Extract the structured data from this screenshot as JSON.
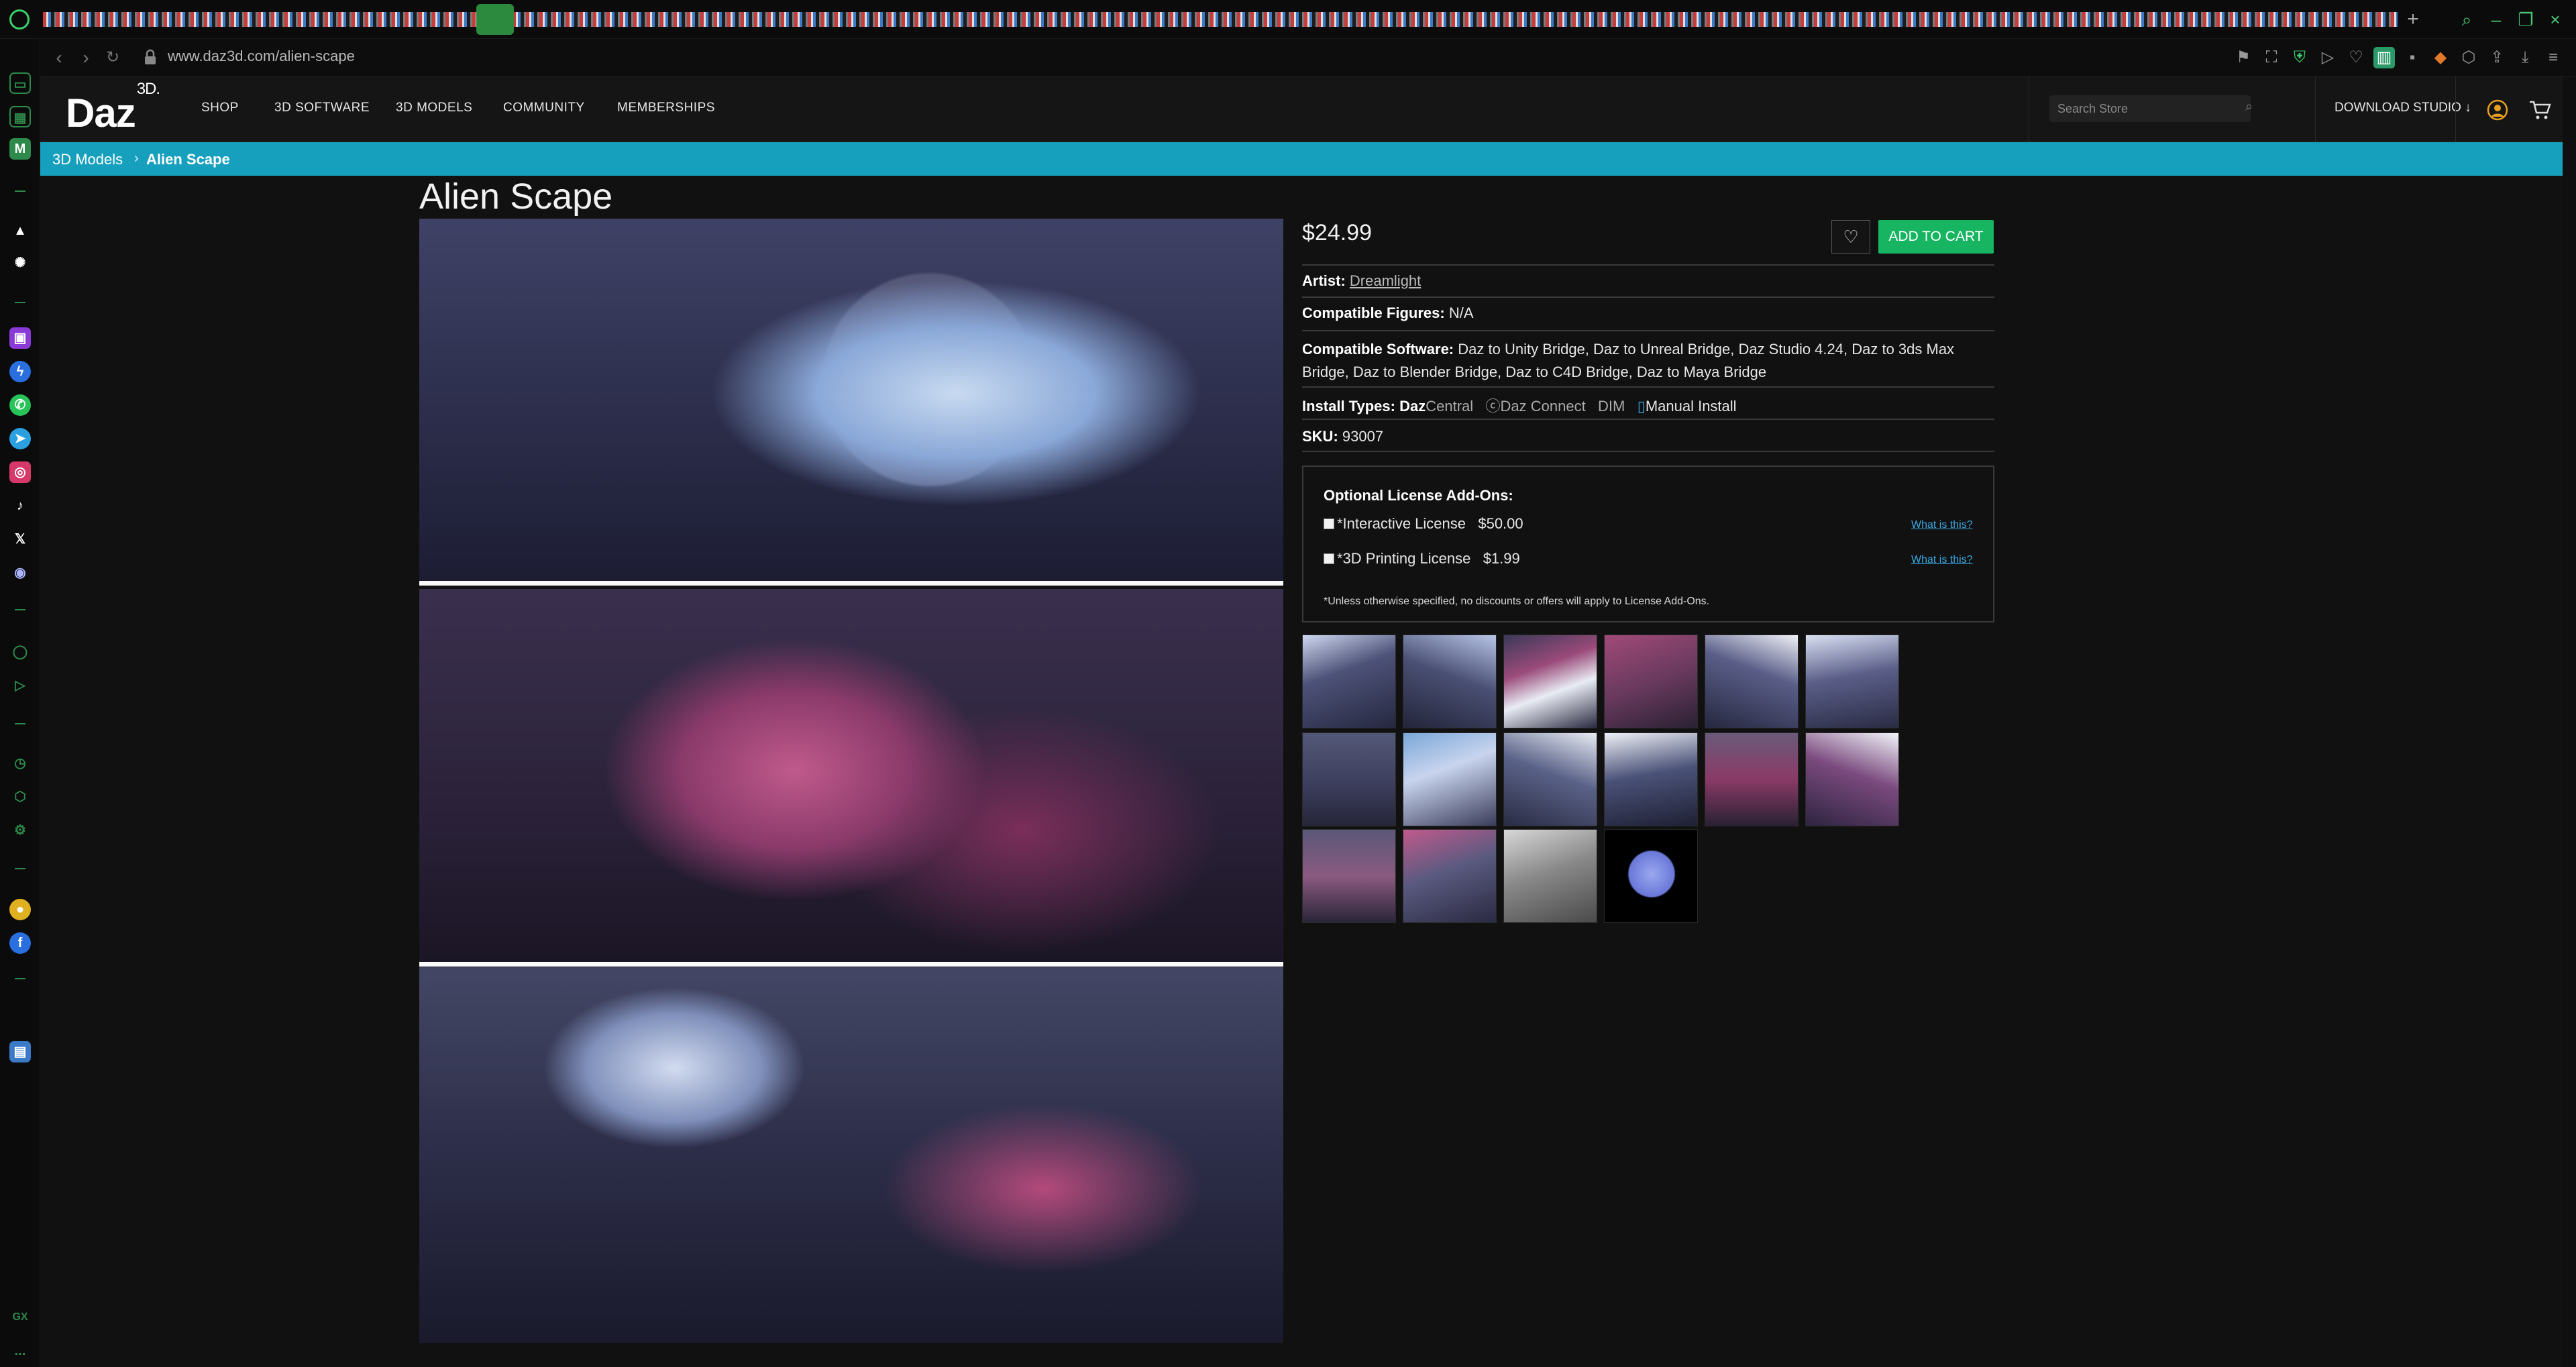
{
  "browser": {
    "url": "www.daz3d.com/alien-scape",
    "extension_icons": [
      "bookmark-icon",
      "screenshot-icon",
      "shield-icon",
      "play-icon",
      "heart-icon",
      "app-icon",
      "vpn-icon",
      "box-icon",
      "puzzle-icon",
      "share-icon",
      "download-icon",
      "menu-icon"
    ],
    "sidebar_icons": [
      "mail-icon",
      "pad-icon",
      "m-icon",
      "a-icon",
      "ai-icon",
      "twitch-icon",
      "messenger-icon",
      "whatsapp-icon",
      "telegram-icon",
      "instagram-icon",
      "tiktok-icon",
      "x-icon",
      "discord-icon",
      "player-icon",
      "send-icon",
      "clock-icon",
      "extensions-icon",
      "settings-icon",
      "chat-icon",
      "facebook-icon",
      "app-icon"
    ],
    "gx_label": "GX",
    "more_label": "..."
  },
  "site": {
    "logo": "Daz",
    "logo_sup": "3D.",
    "nav": [
      "SHOP",
      "3D SOFTWARE",
      "3D MODELS",
      "COMMUNITY",
      "MEMBERSHIPS"
    ],
    "search_placeholder": "Search Store",
    "download_studio": "DOWNLOAD STUDIO",
    "breadcrumb": {
      "parent": "3D Models",
      "sep": "›",
      "current": "Alien Scape"
    }
  },
  "product": {
    "title": "Alien Scape",
    "price": "$24.99",
    "add_to_cart": "ADD TO CART",
    "artist_label": "Artist:",
    "artist": "Dreamlight",
    "figures_label": "Compatible Figures:",
    "figures": "N/A",
    "software_label": "Compatible Software:",
    "software_line1": "Daz to Unity Bridge, Daz to Unreal Bridge, Daz Studio 4.24, Daz to 3ds Max",
    "software_line2": "Bridge, Daz to Blender Bridge, Daz to C4D Bridge, Daz to Maya Bridge",
    "install_label": "Install Types:",
    "install_daz": "Daz",
    "install_central": "Central",
    "install_connect": "Daz Connect",
    "install_dim": "DIM",
    "install_manual": "Manual Install",
    "sku_label": "SKU:",
    "sku": "93007"
  },
  "license": {
    "title": "Optional License Add-Ons:",
    "items": [
      {
        "label": "*Interactive License",
        "price": "$50.00",
        "link": "What is this?"
      },
      {
        "label": "*3D Printing License",
        "price": "$1.99",
        "link": "What is this?"
      }
    ],
    "note": "*Unless otherwise specified, no discounts or offers will apply to License Add-Ons."
  },
  "colors": {
    "accent": "#16a0bd",
    "cart_button": "#17b562",
    "browser_accent": "#3ad06b"
  }
}
